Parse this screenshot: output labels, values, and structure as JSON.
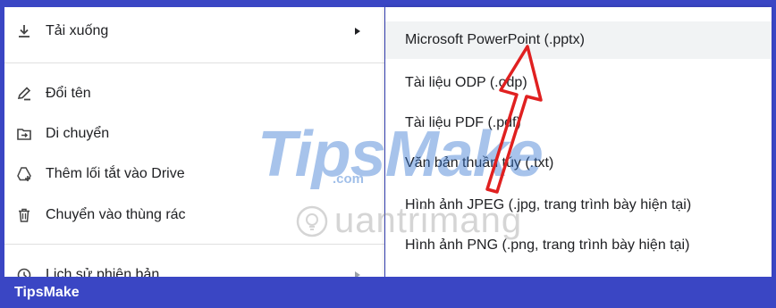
{
  "main_menu": {
    "items": [
      {
        "label": "Tải xuống",
        "icon": "download-icon",
        "has_submenu": true
      },
      {
        "label": "Đổi tên",
        "icon": "rename-icon",
        "has_submenu": false
      },
      {
        "label": "Di chuyển",
        "icon": "move-icon",
        "has_submenu": false
      },
      {
        "label": "Thêm lối tắt vào Drive",
        "icon": "add-shortcut-icon",
        "has_submenu": false
      },
      {
        "label": "Chuyển vào thùng rác",
        "icon": "trash-icon",
        "has_submenu": false
      },
      {
        "label": "Lịch sử phiên bản",
        "icon": "history-icon",
        "has_submenu": true
      }
    ]
  },
  "sub_menu": {
    "items": [
      {
        "label": "Microsoft PowerPoint (.pptx)"
      },
      {
        "label": "Tài liệu ODP (.odp)"
      },
      {
        "label": "Tài liệu PDF (.pdf)"
      },
      {
        "label": "Văn bản thuần túy (.txt)"
      },
      {
        "label": "Hình ảnh JPEG (.jpg, trang trình bày hiện tại)"
      },
      {
        "label": "Hình ảnh PNG (.png, trang trình bày hiện tại)"
      }
    ]
  },
  "watermark": {
    "brand": "TipsMake",
    "domain": ".com",
    "site": "uantrimang"
  },
  "footer": {
    "brand": "TipsMake"
  },
  "colors": {
    "frame": "#3a46c4",
    "annotation_arrow": "#e02020",
    "highlight": "#f1f3f4"
  }
}
